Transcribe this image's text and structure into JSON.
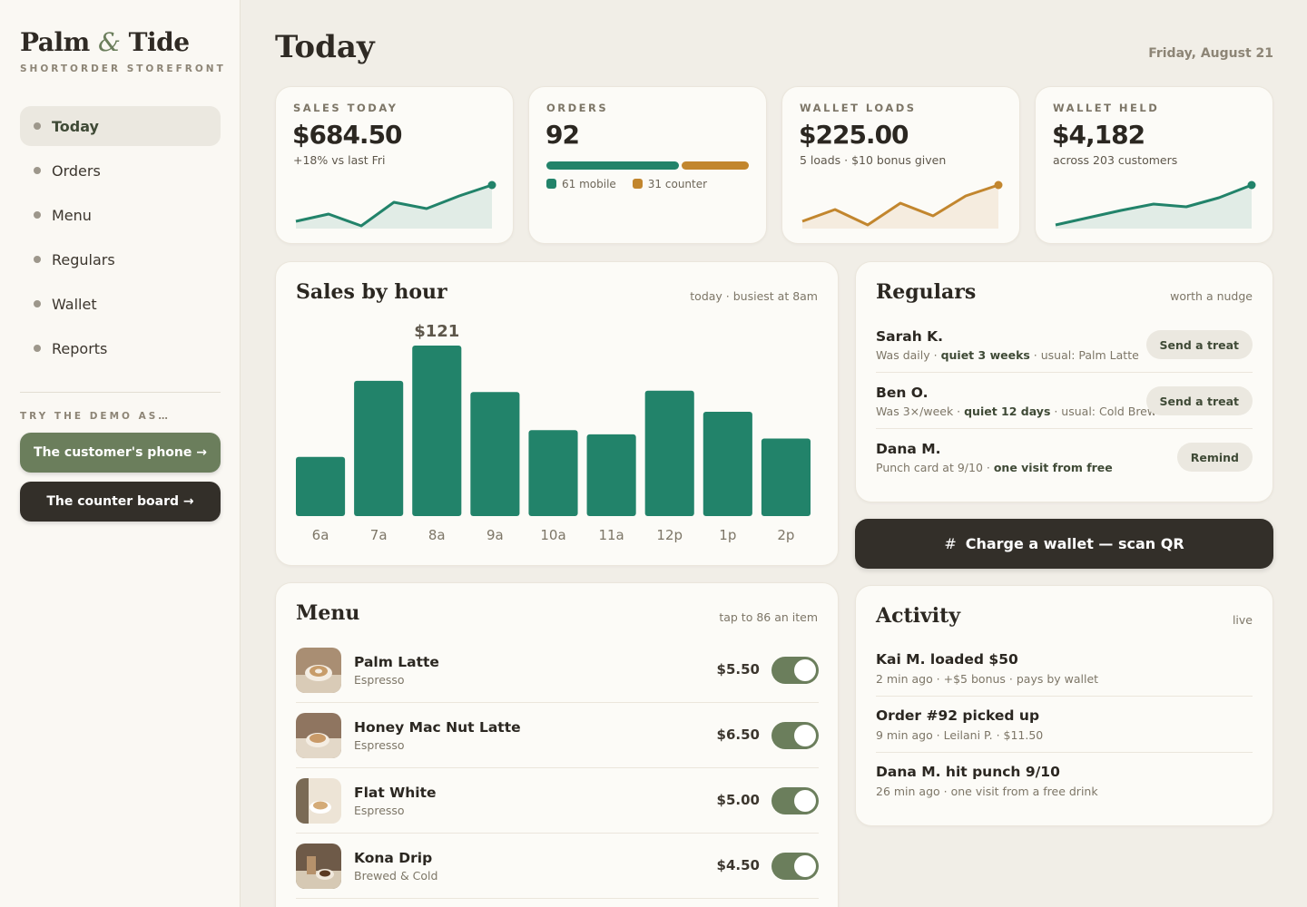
{
  "brand": {
    "name_a": "Palm ",
    "amp": "&",
    "name_b": " Tide",
    "subtitle": "SHORTORDER STOREFRONT"
  },
  "nav": {
    "items": [
      {
        "label": "Today",
        "active": true
      },
      {
        "label": "Orders"
      },
      {
        "label": "Menu"
      },
      {
        "label": "Regulars"
      },
      {
        "label": "Wallet"
      },
      {
        "label": "Reports"
      }
    ]
  },
  "demo": {
    "label": "TRY THE DEMO AS…",
    "phone_button": "The customer's phone →",
    "board_button": "The counter board →"
  },
  "header": {
    "title": "Today",
    "date": "Friday, August 21"
  },
  "stats": {
    "sales": {
      "label": "SALES TODAY",
      "value": "$684.50",
      "sub": "+18% vs last Fri"
    },
    "orders": {
      "label": "ORDERS",
      "value": "92",
      "mobile": 61,
      "counter": 31,
      "mobile_label": "61 mobile",
      "counter_label": "31 counter"
    },
    "wallet_loads": {
      "label": "WALLET LOADS",
      "value": "$225.00",
      "sub": "5 loads · $10 bonus given"
    },
    "wallet_held": {
      "label": "WALLET HELD",
      "value": "$4,182",
      "sub": "across 203 customers"
    }
  },
  "colors": {
    "green": "#22836a",
    "gold": "#c2862e",
    "sage": "#6b7e5c",
    "dark": "#332f29"
  },
  "sales_by_hour": {
    "title": "Sales by hour",
    "hint": "today · busiest at 8am",
    "peak_label": "$121"
  },
  "chart_data": {
    "type": "bar",
    "categories": [
      "6a",
      "7a",
      "8a",
      "9a",
      "10a",
      "11a",
      "12p",
      "1p",
      "2p"
    ],
    "values": [
      42,
      96,
      121,
      88,
      61,
      58,
      89,
      74,
      55
    ],
    "ylim": [
      0,
      121
    ],
    "annotations": [
      {
        "category": "8a",
        "text": "$121"
      }
    ]
  },
  "regulars": {
    "title": "Regulars",
    "hint": "worth a nudge",
    "items": [
      {
        "name": "Sarah K.",
        "desc_a": "Was daily · ",
        "desc_b": "quiet 3 weeks",
        "desc_c": " · usual: Palm Latte",
        "action": "Send a treat"
      },
      {
        "name": "Ben O.",
        "desc_a": "Was 3×/week · ",
        "desc_b": "quiet 12 days",
        "desc_c": " · usual: Cold Brew",
        "action": "Send a treat"
      },
      {
        "name": "Dana M.",
        "desc_a": "Punch card at 9/10 · ",
        "desc_b": "one visit from free",
        "desc_c": "",
        "action": "Remind"
      }
    ]
  },
  "charge": {
    "icon": "#",
    "label": "Charge a wallet — scan QR"
  },
  "activity": {
    "title": "Activity",
    "hint": "live",
    "items": [
      {
        "title": "Kai M. loaded $50",
        "sub": "2 min ago · +$5 bonus · pays by wallet"
      },
      {
        "title": "Order #92 picked up",
        "sub": "9 min ago · Leilani P. · $11.50"
      },
      {
        "title": "Dana M. hit punch 9/10",
        "sub": "26 min ago · one visit from a free drink"
      }
    ]
  },
  "menu": {
    "title": "Menu",
    "hint": "tap to 86 an item",
    "items": [
      {
        "name": "Palm Latte",
        "category": "Espresso",
        "price": "$5.50",
        "available": true
      },
      {
        "name": "Honey Mac Nut Latte",
        "category": "Espresso",
        "price": "$6.50",
        "available": true
      },
      {
        "name": "Flat White",
        "category": "Espresso",
        "price": "$5.00",
        "available": true
      },
      {
        "name": "Kona Drip",
        "category": "Brewed & Cold",
        "price": "$4.50",
        "available": true
      }
    ]
  }
}
